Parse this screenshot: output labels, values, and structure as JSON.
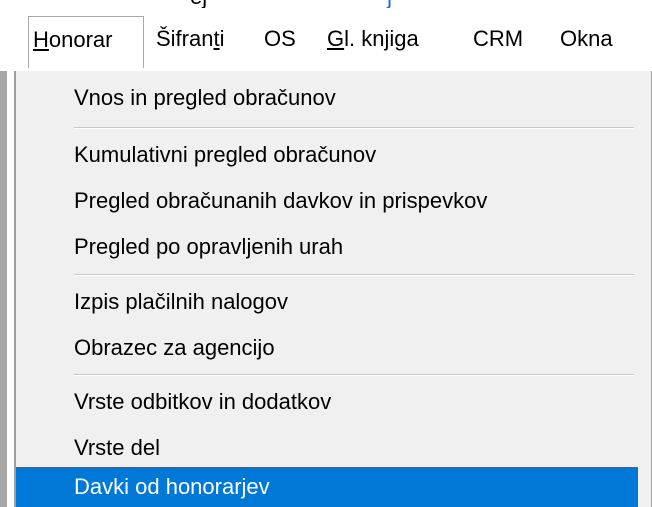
{
  "window": {
    "title_text": "ej",
    "title_link_text": "j"
  },
  "menubar": {
    "items": [
      {
        "label_underlined": "H",
        "label_rest": "onorar"
      },
      {
        "label_pre": "Šifran",
        "label_underlined": "t",
        "label_rest": "i"
      },
      {
        "label": "OS"
      },
      {
        "label_underlined": "G",
        "label_rest": "l. knjiga"
      },
      {
        "label": "CRM"
      },
      {
        "label": "Okna"
      }
    ]
  },
  "dropdown": {
    "items": [
      "Vnos in pregled obračunov",
      "Kumulativni pregled obračunov",
      "Pregled obračunanih davkov in prispevkov",
      "Pregled po opravljenih urah",
      "Izpis plačilnih nalogov",
      "Obrazec za agencijo",
      "Vrste odbitkov in dodatkov",
      "Vrste del",
      "Davki od honorarjev"
    ],
    "selected_index": 8
  },
  "colors": {
    "selection": "#0078d7",
    "menu_bg": "#f0f0f0",
    "link": "#1a6fd0"
  }
}
